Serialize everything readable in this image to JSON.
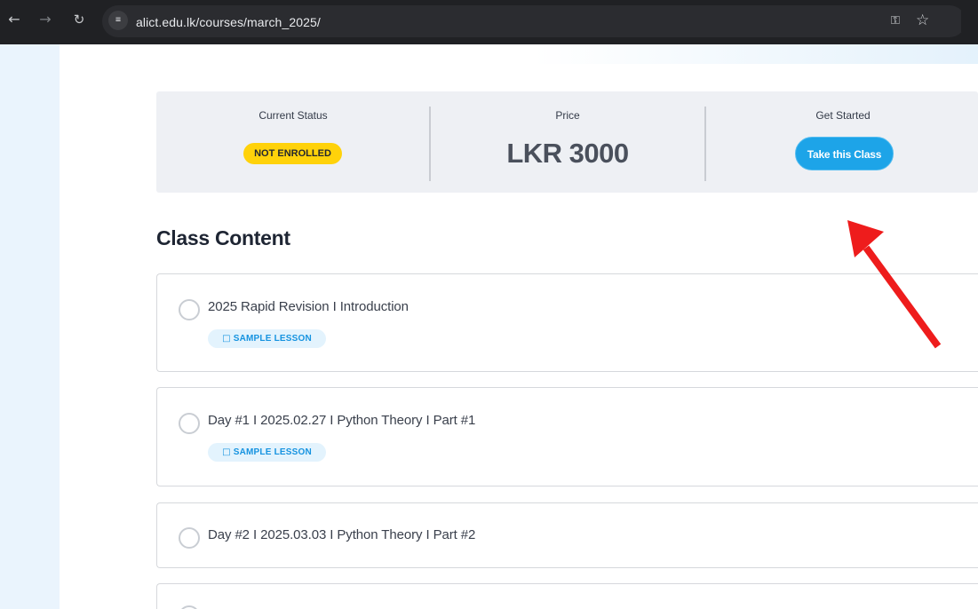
{
  "browser": {
    "url": "alict.edu.lk/courses/march_2025/",
    "icons": {
      "back": "arrow-left-icon",
      "forward": "arrow-right-icon",
      "reload": "reload-icon",
      "site_info": "tune-icon",
      "password": "key-icon",
      "bookmark": "star-outline-icon"
    }
  },
  "status_bar": {
    "current_status_label": "Current Status",
    "current_status_value": "NOT ENROLLED",
    "price_label": "Price",
    "price_value": "LKR 3000",
    "get_started_label": "Get Started",
    "take_class_button": "Take this Class"
  },
  "content": {
    "title": "Class Content",
    "lessons": [
      {
        "title": "2025 Rapid Revision I Introduction",
        "tag": "SAMPLE LESSON"
      },
      {
        "title": "Day #1 I 2025.02.27 I Python Theory I Part #1",
        "tag": "SAMPLE LESSON"
      },
      {
        "title": "Day #2 I 2025.03.03 I Python Theory I Part #2"
      }
    ]
  },
  "colors": {
    "chrome_bg": "#202124",
    "status_badge": "#ffd20a",
    "primary_button": "#1da4e8",
    "sample_tag_bg": "#e3f3fd",
    "sample_tag_text": "#1693e0",
    "annotation_arrow": "#ee1c1c"
  }
}
